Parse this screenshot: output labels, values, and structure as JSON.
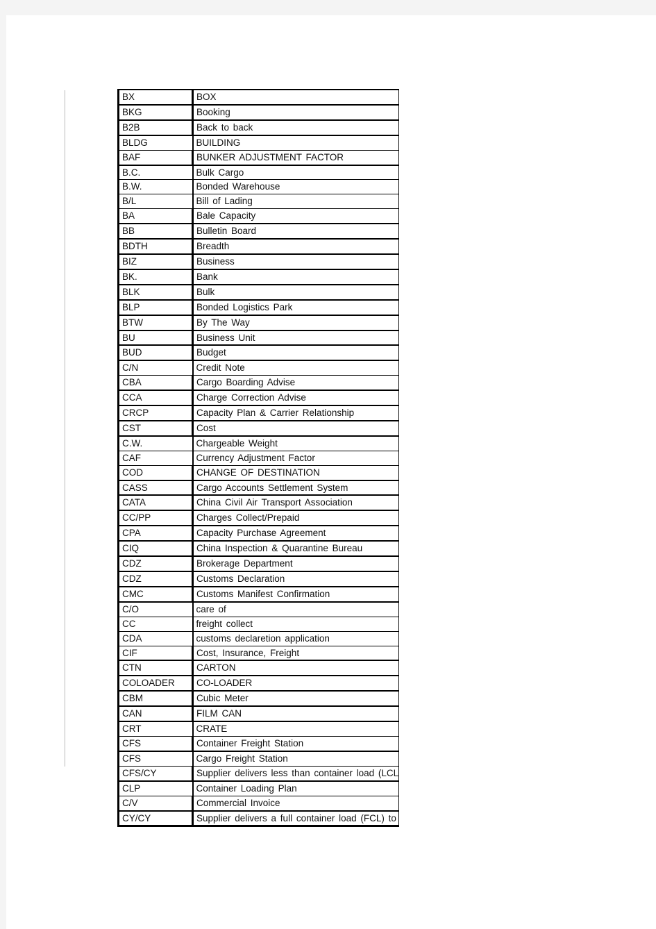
{
  "document": {
    "page_background": "#ffffff",
    "viewer_background": "#f4f4f4",
    "text_color": "#101010",
    "border_color": "#000000",
    "margin_rule_color": "#b9b9b9"
  },
  "table": {
    "columns": [
      "code",
      "meaning"
    ],
    "rows": [
      {
        "code": "BX",
        "meaning": "BOX",
        "light": false
      },
      {
        "code": "BKG",
        "meaning": "Booking",
        "light": false
      },
      {
        "code": "B2B",
        "meaning": "Back to back",
        "light": false
      },
      {
        "code": "BLDG",
        "meaning": "BUILDING",
        "light": true
      },
      {
        "code": "BAF",
        "meaning": "BUNKER ADJUSTMENT FACTOR",
        "light": false
      },
      {
        "code": "B.C.",
        "meaning": "Bulk Cargo",
        "light": true
      },
      {
        "code": "B.W.",
        "meaning": "Bonded Warehouse",
        "light": true
      },
      {
        "code": "B/L",
        "meaning": "Bill of Lading",
        "light": true
      },
      {
        "code": "BA",
        "meaning": "Bale Capacity",
        "light": false
      },
      {
        "code": "BB",
        "meaning": "Bulletin Board",
        "light": false
      },
      {
        "code": "BDTH",
        "meaning": "Breadth",
        "light": false
      },
      {
        "code": "BIZ",
        "meaning": "Business",
        "light": false
      },
      {
        "code": "BK.",
        "meaning": "Bank",
        "light": false
      },
      {
        "code": "BLK",
        "meaning": "Bulk",
        "light": false
      },
      {
        "code": "BLP",
        "meaning": "Bonded Logistics Park",
        "light": false
      },
      {
        "code": "BTW",
        "meaning": "By The Way",
        "light": false
      },
      {
        "code": "BU",
        "meaning": "Business Unit",
        "light": false
      },
      {
        "code": "BUD",
        "meaning": "Budget",
        "light": false
      },
      {
        "code": "C/N",
        "meaning": "Credit Note",
        "light": true
      },
      {
        "code": "CBA",
        "meaning": "Cargo Boarding Advise",
        "light": false
      },
      {
        "code": "CCA",
        "meaning": "Charge Correction Advise",
        "light": false
      },
      {
        "code": "CRCP",
        "meaning": "Capacity Plan & Carrier Relationship",
        "light": false
      },
      {
        "code": "CST",
        "meaning": "Cost",
        "light": false
      },
      {
        "code": "C.W.",
        "meaning": "Chargeable Weight",
        "light": true
      },
      {
        "code": "CAF",
        "meaning": "Currency Adjustment Factor",
        "light": true
      },
      {
        "code": "COD",
        "meaning": "CHANGE OF DESTINATION",
        "light": false
      },
      {
        "code": "CASS",
        "meaning": "Cargo Accounts Settlement System",
        "light": false
      },
      {
        "code": "CATA",
        "meaning": "China Civil Air Transport Association",
        "light": false
      },
      {
        "code": "CC/PP",
        "meaning": "Charges Collect/Prepaid",
        "light": false
      },
      {
        "code": "CPA",
        "meaning": "Capacity Purchase Agreement",
        "light": false
      },
      {
        "code": "CIQ",
        "meaning": "China Inspection & Quarantine Bureau",
        "light": false
      },
      {
        "code": "CDZ",
        "meaning": "Brokerage Department",
        "light": false
      },
      {
        "code": "CDZ",
        "meaning": "Customs Declaration",
        "light": false
      },
      {
        "code": "CMC",
        "meaning": "Customs Manifest Confirmation",
        "light": false
      },
      {
        "code": "C/O",
        "meaning": "care of",
        "light": true
      },
      {
        "code": "CC",
        "meaning": "freight collect",
        "light": true
      },
      {
        "code": "CDA",
        "meaning": "customs declaretion application",
        "light": true
      },
      {
        "code": "CIF",
        "meaning": "Cost, Insurance, Freight",
        "light": false
      },
      {
        "code": "CTN",
        "meaning": "CARTON",
        "light": false
      },
      {
        "code": "COLOADER",
        "meaning": "CO-LOADER",
        "light": false
      },
      {
        "code": "CBM",
        "meaning": "Cubic Meter",
        "light": false
      },
      {
        "code": "CAN",
        "meaning": "FILM CAN",
        "light": false
      },
      {
        "code": "CRT",
        "meaning": "CRATE",
        "light": true
      },
      {
        "code": "CFS",
        "meaning": "Container Freight Station",
        "light": false
      },
      {
        "code": "CFS",
        "meaning": "Cargo Freight Station",
        "light": true
      },
      {
        "code": "CFS/CY",
        "meaning": "Supplier delivers less than container load (LCL",
        "light": false
      },
      {
        "code": "CLP",
        "meaning": "Container Loading Plan",
        "light": true
      },
      {
        "code": "C/V",
        "meaning": "Commercial Invoice",
        "light": false
      },
      {
        "code": "CY/CY",
        "meaning": "Supplier delivers a full container load (FCL) to",
        "light": false
      }
    ]
  }
}
